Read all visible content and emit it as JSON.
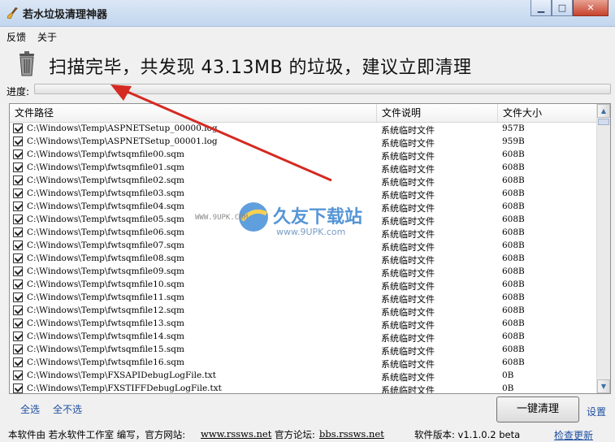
{
  "window": {
    "title": "若水垃圾清理神器",
    "minimize": "▁",
    "maximize": "□",
    "close": "✕"
  },
  "menu": [
    "反馈",
    "关于"
  ],
  "status": {
    "headline": "扫描完毕，共发现 43.13MB 的垃圾，建议立即清理"
  },
  "progress": {
    "label": "进度:",
    "value": 0
  },
  "table": {
    "columns": [
      "文件路径",
      "文件说明",
      "文件大小"
    ],
    "rows": [
      [
        "C:\\Windows\\Temp\\ASPNETSetup_00000.log",
        "系统临时文件",
        "957B"
      ],
      [
        "C:\\Windows\\Temp\\ASPNETSetup_00001.log",
        "系统临时文件",
        "959B"
      ],
      [
        "C:\\Windows\\Temp\\fwtsqmfile00.sqm",
        "系统临时文件",
        "608B"
      ],
      [
        "C:\\Windows\\Temp\\fwtsqmfile01.sqm",
        "系统临时文件",
        "608B"
      ],
      [
        "C:\\Windows\\Temp\\fwtsqmfile02.sqm",
        "系统临时文件",
        "608B"
      ],
      [
        "C:\\Windows\\Temp\\fwtsqmfile03.sqm",
        "系统临时文件",
        "608B"
      ],
      [
        "C:\\Windows\\Temp\\fwtsqmfile04.sqm",
        "系统临时文件",
        "608B"
      ],
      [
        "C:\\Windows\\Temp\\fwtsqmfile05.sqm",
        "系统临时文件",
        "608B"
      ],
      [
        "C:\\Windows\\Temp\\fwtsqmfile06.sqm",
        "系统临时文件",
        "608B"
      ],
      [
        "C:\\Windows\\Temp\\fwtsqmfile07.sqm",
        "系统临时文件",
        "608B"
      ],
      [
        "C:\\Windows\\Temp\\fwtsqmfile08.sqm",
        "系统临时文件",
        "608B"
      ],
      [
        "C:\\Windows\\Temp\\fwtsqmfile09.sqm",
        "系统临时文件",
        "608B"
      ],
      [
        "C:\\Windows\\Temp\\fwtsqmfile10.sqm",
        "系统临时文件",
        "608B"
      ],
      [
        "C:\\Windows\\Temp\\fwtsqmfile11.sqm",
        "系统临时文件",
        "608B"
      ],
      [
        "C:\\Windows\\Temp\\fwtsqmfile12.sqm",
        "系统临时文件",
        "608B"
      ],
      [
        "C:\\Windows\\Temp\\fwtsqmfile13.sqm",
        "系统临时文件",
        "608B"
      ],
      [
        "C:\\Windows\\Temp\\fwtsqmfile14.sqm",
        "系统临时文件",
        "608B"
      ],
      [
        "C:\\Windows\\Temp\\fwtsqmfile15.sqm",
        "系统临时文件",
        "608B"
      ],
      [
        "C:\\Windows\\Temp\\fwtsqmfile16.sqm",
        "系统临时文件",
        "608B"
      ],
      [
        "C:\\Windows\\Temp\\FXSAPIDebugLogFile.txt",
        "系统临时文件",
        "0B"
      ],
      [
        "C:\\Windows\\Temp\\FXSTIFFDebugLogFile.txt",
        "系统临时文件",
        "0B"
      ]
    ]
  },
  "actions": {
    "select_all": "全选",
    "select_none": "全不选",
    "clean": "一键清理",
    "settings": "设置"
  },
  "footer": {
    "author": "本软件由 若水软件工作室 编写，官方网站:",
    "site": "www.rssws.net",
    "forum_label": "官方论坛:",
    "forum": "bbs.rssws.net",
    "version": "软件版本: v1.1.0.2 beta",
    "check_update": "检查更新"
  },
  "watermark": {
    "brand": "久友下载站",
    "url": "www.9UPK.com",
    "small": "WWW.9UPK.COM"
  },
  "colors": {
    "arrow": "#d42a22",
    "link": "#1f4fa0",
    "titlebar": "#c2d6ee"
  }
}
